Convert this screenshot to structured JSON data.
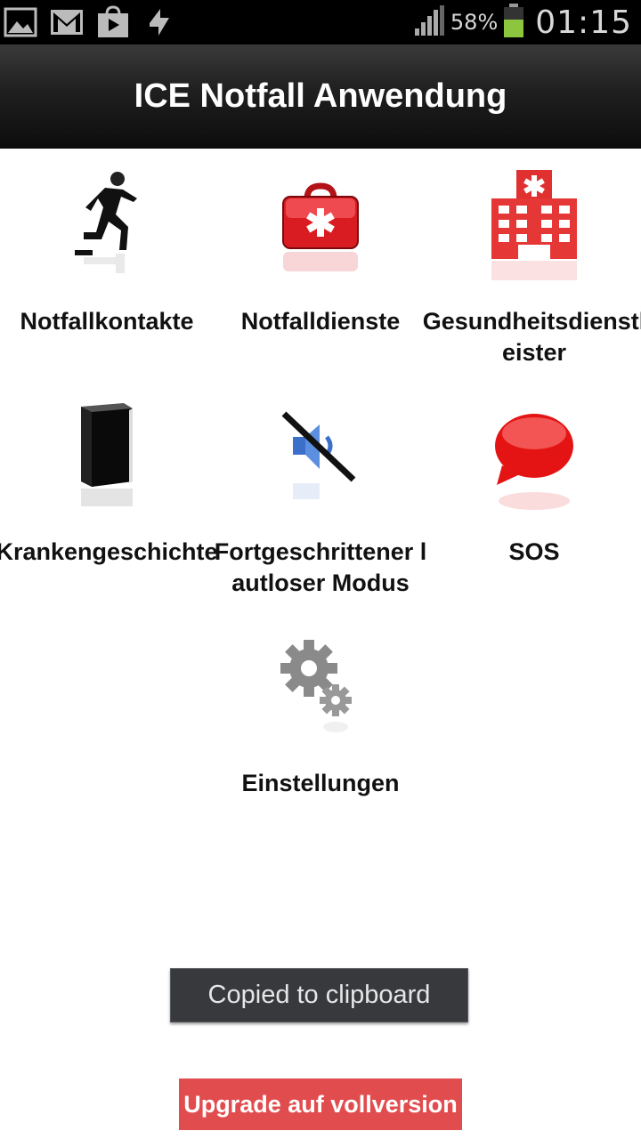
{
  "status_bar": {
    "battery_percent": "58%",
    "clock": "01:15",
    "icons": [
      "image-icon",
      "gmail-icon",
      "play-store-icon",
      "sync-icon",
      "signal-icon",
      "battery-icon"
    ],
    "battery_level": 0.58,
    "battery_color": "#8cc63f"
  },
  "app": {
    "title": "ICE Notfall Anwendung",
    "title_bar_color": "#1f1f1f"
  },
  "menu": {
    "items": [
      {
        "label": "Notfallkontakte",
        "icon": "running-person-icon"
      },
      {
        "label": "Notfalldienste",
        "icon": "first-aid-kit-icon"
      },
      {
        "label": "Gesundheitsdienstleister",
        "icon": "hospital-icon"
      },
      {
        "label": "Krankengeschichte",
        "icon": "book-icon"
      },
      {
        "label": "Fortgeschrittener lautloser Modus",
        "icon": "muted-speaker-icon"
      },
      {
        "label": "SOS",
        "icon": "speech-bubble-icon"
      },
      {
        "label": "Einstellungen",
        "icon": "gears-icon"
      }
    ]
  },
  "toast": {
    "text": "Copied to clipboard"
  },
  "upgrade_button": {
    "label": "Upgrade auf vollversion",
    "color": "#e14d4f"
  }
}
